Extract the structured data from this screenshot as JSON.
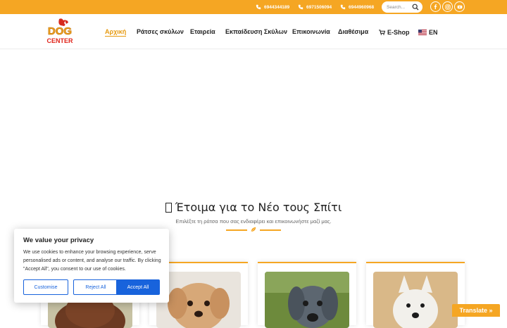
{
  "topbar": {
    "phones": [
      "6944344189",
      "6971506094",
      "6944960968"
    ],
    "search_placeholder": "Search...",
    "social": [
      "facebook-icon",
      "instagram-icon",
      "youtube-icon"
    ],
    "bg_color": "#f5a623"
  },
  "logo": {
    "line1": "DOG",
    "line2": "CENTER"
  },
  "nav": {
    "items": [
      "Αρχική",
      "Ράτσες σκύλων",
      "Εταιρεία",
      "Εκπαίδευση Σκύλων",
      "Επικοινωνία",
      "Διαθέσιμα",
      "E-Shop",
      "EN"
    ],
    "active_index": 0,
    "accent": "#e69a10"
  },
  "section": {
    "title": "Έτοιμα για το Νέο τους Σπίτι",
    "subtitle": "Επιλέξτε τη ράτσα που σας ενδιαφέρει και επικοινωνήστε μαζί μας."
  },
  "cookie": {
    "title": "We value your privacy",
    "body": "We use cookies to enhance your browsing experience, serve personalised ads or content, and analyse our traffic. By clicking \"Accept All\", you consent to our use of cookies.",
    "customise": "Customise",
    "reject": "Reject All",
    "accept": "Accept All",
    "button_color": "#1863dc"
  },
  "translate": {
    "label": "Translate »"
  }
}
